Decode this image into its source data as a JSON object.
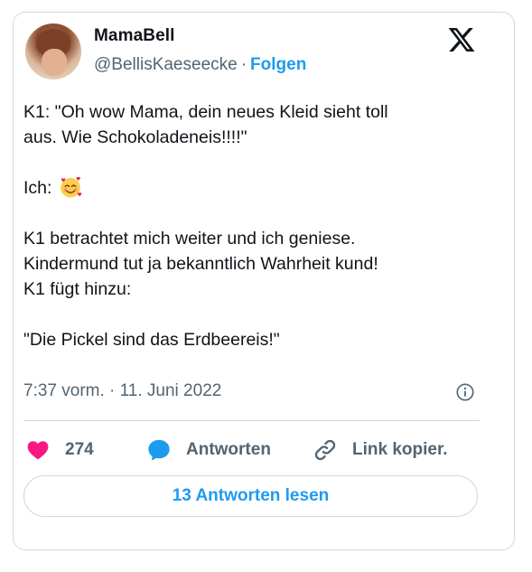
{
  "author": {
    "name": "MamaBell",
    "handle": "@BellisKaeseecke",
    "separator": "·",
    "follow_label": "Folgen"
  },
  "tweet": {
    "line1": "K1: \"Oh wow Mama, dein neues Kleid sieht toll",
    "line2": "aus. Wie Schokoladeneis!!!!\"",
    "line3": "Ich:",
    "line3_emoji": "smiling-face-with-hearts-icon",
    "line4": "K1 betrachtet mich weiter und ich geniese.",
    "line5": "Kindermund tut ja bekanntlich Wahrheit kund!",
    "line6": "K1 fügt hinzu:",
    "line7": "\"Die Pickel sind das Erdbeereis!\""
  },
  "meta": {
    "timestamp": "7:37 vorm. · 11. Juni 2022"
  },
  "actions": {
    "like_count": "274",
    "reply_label": "Antworten",
    "copy_label": "Link kopier."
  },
  "read_replies_label": "13 Antworten lesen",
  "colors": {
    "accent": "#1d9bf0",
    "like": "#f91880",
    "muted": "#536471",
    "border": "#cfd9de"
  }
}
